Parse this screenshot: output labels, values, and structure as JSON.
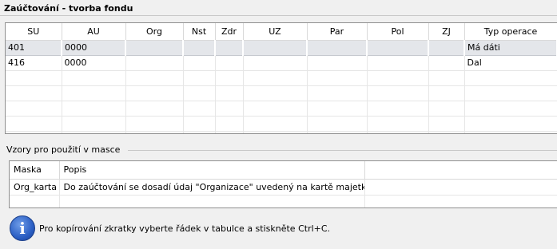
{
  "title": "Zaúčtování - tvorba fondu",
  "grid": {
    "columns": [
      "SU",
      "AU",
      "Org",
      "Nst",
      "Zdr",
      "UZ",
      "Par",
      "Pol",
      "ZJ",
      "Typ operace"
    ],
    "rows": [
      [
        "401",
        "0000",
        "",
        "",
        "",
        "",
        "",
        "",
        "",
        "Má dáti"
      ],
      [
        "416",
        "0000",
        "",
        "",
        "",
        "",
        "",
        "",
        "",
        "Dal"
      ]
    ]
  },
  "masks_section": {
    "label": "Vzory pro použití v masce",
    "columns": [
      "Maska",
      "Popis"
    ],
    "rows": [
      [
        "Org_karta",
        "Do zaúčtování se dosadí údaj \"Organizace\" uvedený na kartě majetku."
      ]
    ]
  },
  "info": {
    "icon": "info-icon",
    "glyph": "i",
    "text": "Pro kopírování zkratky vyberte řádek v tabulce a stiskněte Ctrl+C."
  }
}
